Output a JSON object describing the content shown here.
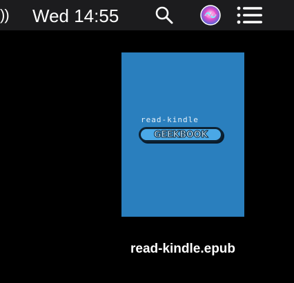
{
  "menubar": {
    "volume_fragment": "))",
    "clock": "Wed 14:55",
    "icons": {
      "search": "search-icon",
      "siri": "siri-icon",
      "notification_center": "list-icon"
    },
    "colors": {
      "background": "#1c1c1e",
      "text": "#ffffff"
    }
  },
  "desktop": {
    "background": "#000000",
    "file": {
      "name": "read-kindle.epub",
      "cover": {
        "subtitle": "read-kindle",
        "logo": "GEEKBOOK",
        "background": "#2a7fbe"
      }
    }
  }
}
